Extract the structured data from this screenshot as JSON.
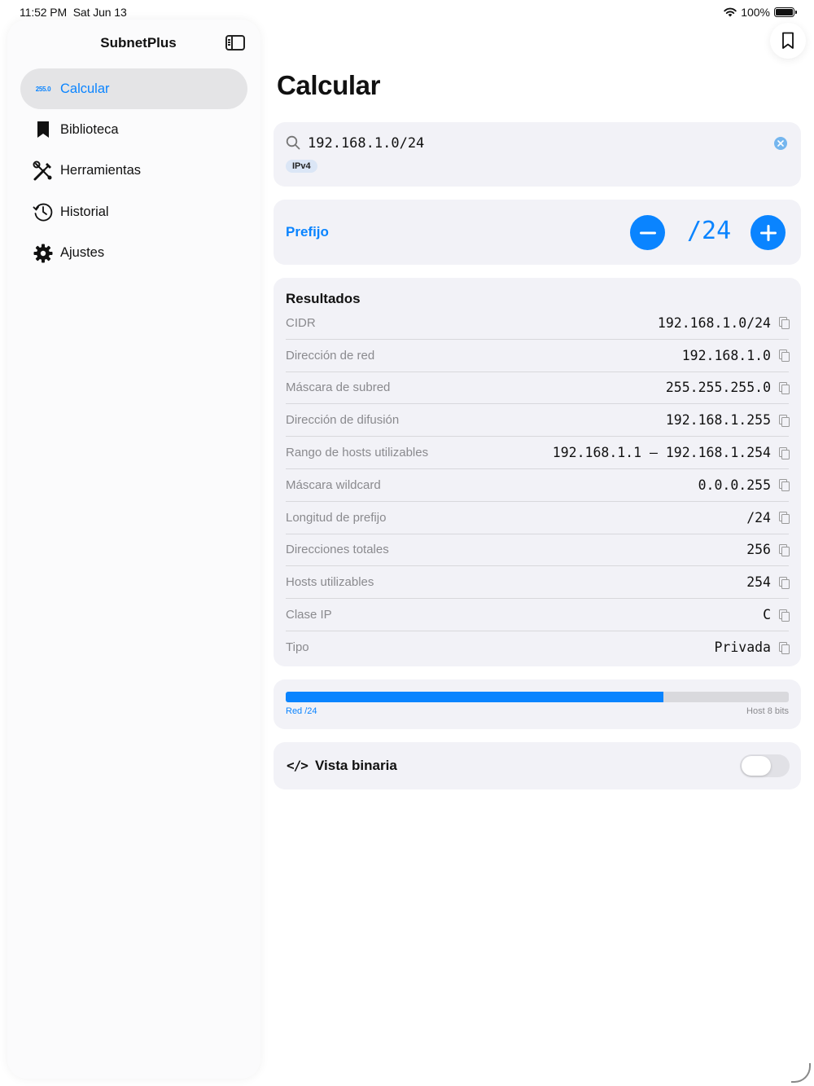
{
  "status_bar": {
    "time": "11:52 PM",
    "date": "Sat Jun 13",
    "battery": "100%"
  },
  "sidebar": {
    "title": "SubnetPlus",
    "items": [
      {
        "label": "Calcular",
        "icon": "255.0",
        "active": true
      },
      {
        "label": "Biblioteca",
        "icon": "bookmark-icon"
      },
      {
        "label": "Herramientas",
        "icon": "tools-icon"
      },
      {
        "label": "Historial",
        "icon": "history-icon"
      },
      {
        "label": "Ajustes",
        "icon": "gear-icon"
      }
    ]
  },
  "main": {
    "title": "Calcular",
    "search": {
      "value": "192.168.1.0/24",
      "badge": "IPv4"
    },
    "prefix": {
      "label": "Prefijo",
      "value": "/24"
    },
    "results": {
      "title": "Resultados",
      "rows": [
        {
          "label": "CIDR",
          "value": "192.168.1.0/24"
        },
        {
          "label": "Dirección de red",
          "value": "192.168.1.0"
        },
        {
          "label": "Máscara de subred",
          "value": "255.255.255.0"
        },
        {
          "label": "Dirección de difusión",
          "value": "192.168.1.255"
        },
        {
          "label": "Rango de hosts utilizables",
          "value": "192.168.1.1 – 192.168.1.254"
        },
        {
          "label": "Máscara wildcard",
          "value": "0.0.0.255"
        },
        {
          "label": "Longitud de prefijo",
          "value": "/24"
        },
        {
          "label": "Direcciones totales",
          "value": "256"
        },
        {
          "label": "Hosts utilizables",
          "value": "254"
        },
        {
          "label": "Clase IP",
          "value": "C"
        },
        {
          "label": "Tipo",
          "value": "Privada"
        }
      ]
    },
    "bits_bar": {
      "network_label": "Red /24",
      "host_label": "Host 8 bits",
      "network_fraction": 0.75
    },
    "binary_view": {
      "icon": "</>",
      "label": "Vista binaria",
      "enabled": false
    }
  },
  "colors": {
    "accent": "#0a84ff",
    "card": "#f2f2f7"
  }
}
